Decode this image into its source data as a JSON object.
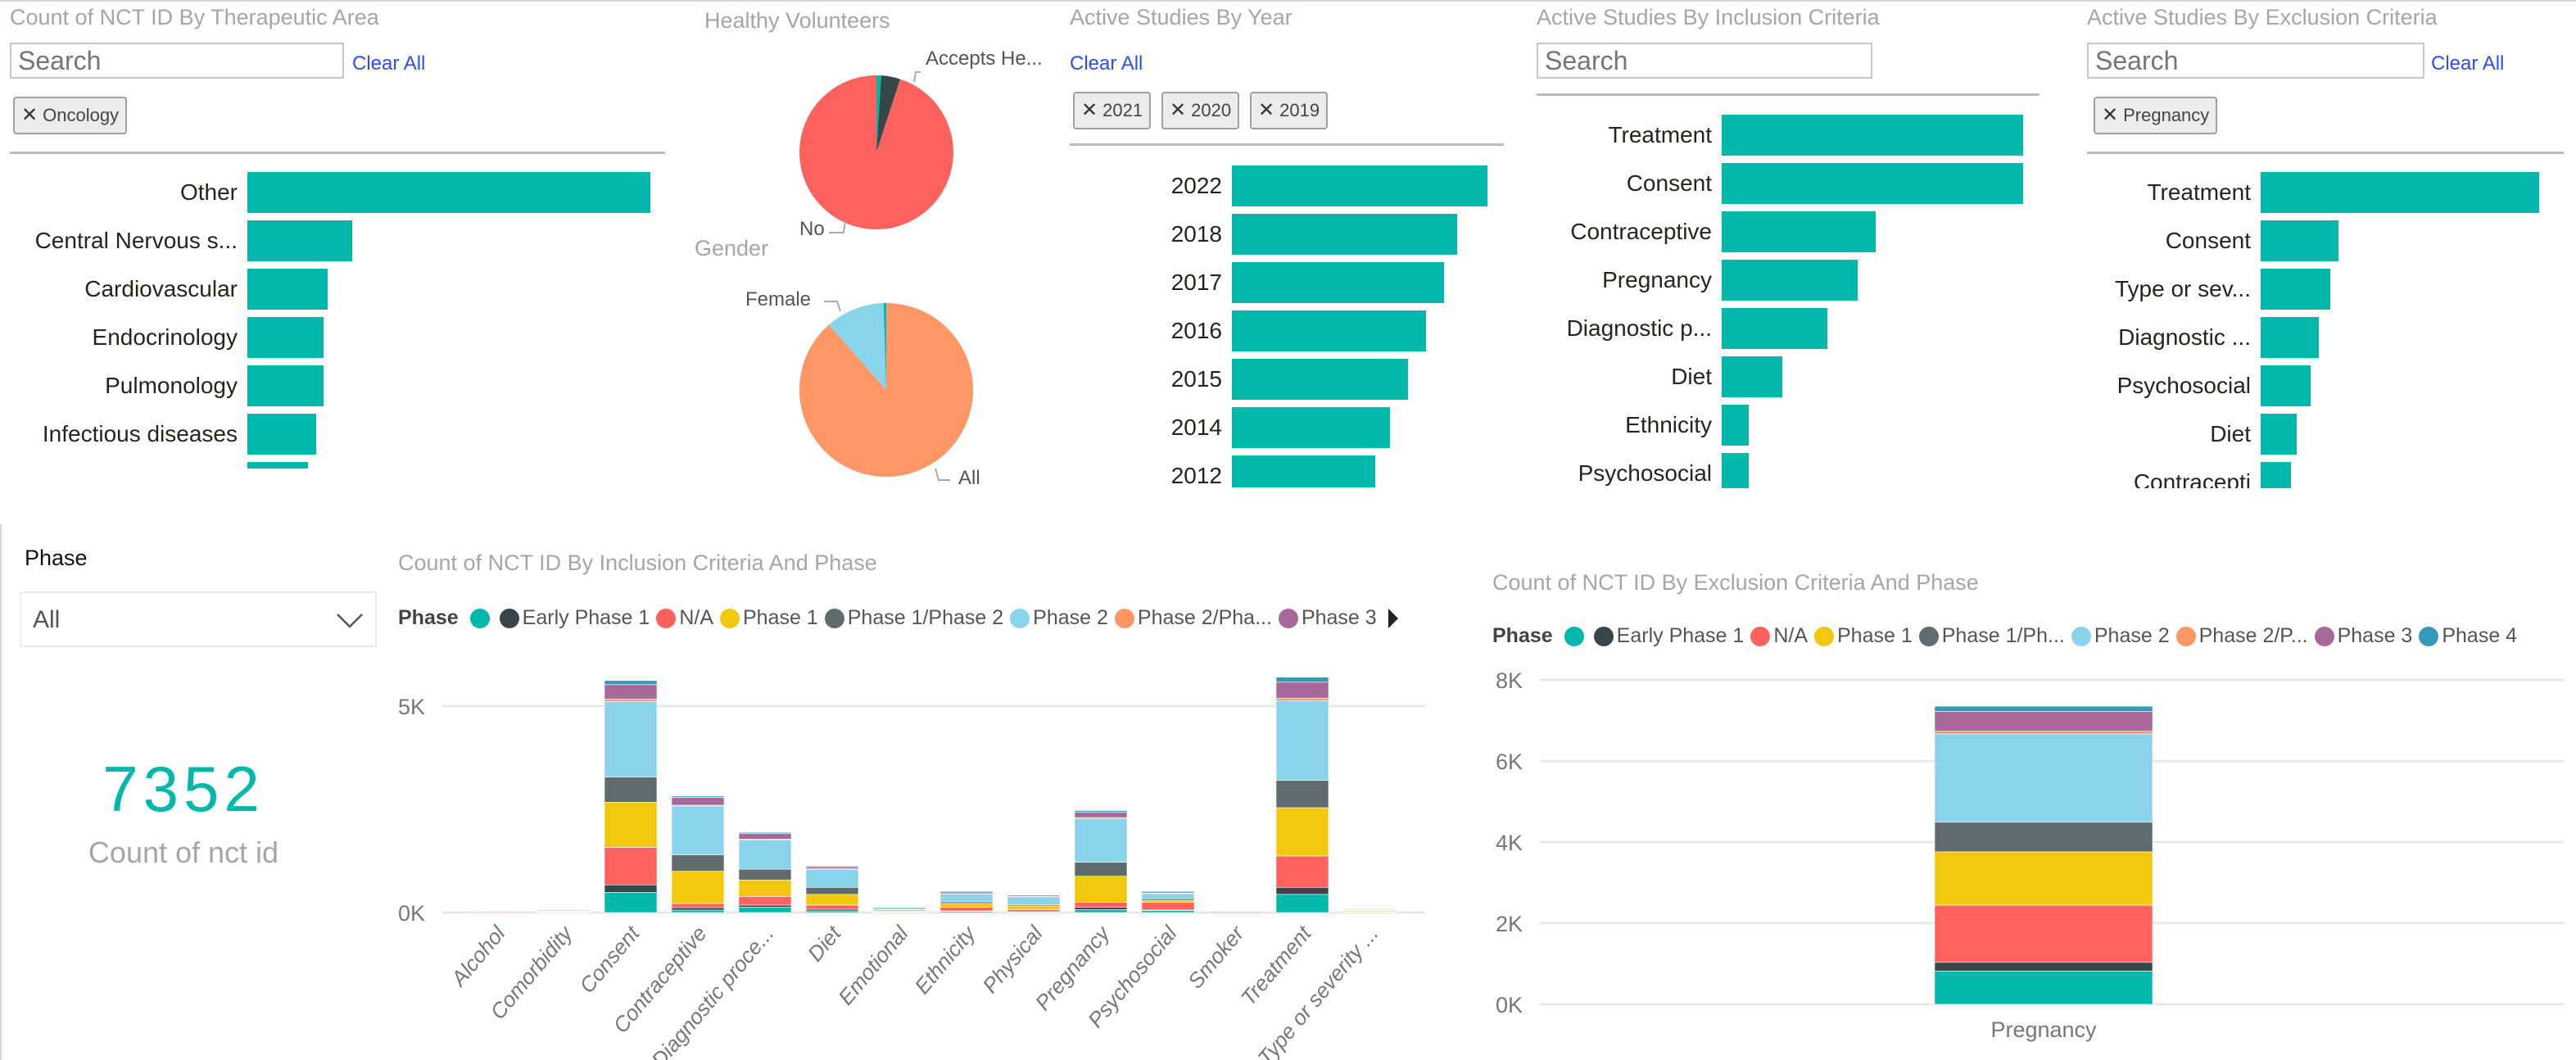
{
  "colors": {
    "accent": "#01B8AA",
    "link": "#2b4cff",
    "phase": [
      "#01B8AA",
      "#374649",
      "#FD625E",
      "#F2C80F",
      "#5F6B6D",
      "#8AD4EB",
      "#FE9666",
      "#A66999",
      "#3599B8"
    ]
  },
  "therapeutic": {
    "title": "Count of NCT ID By Therapeutic Area",
    "search_placeholder": "Search",
    "clear_all": "Clear All",
    "chips": [
      "Oncology"
    ],
    "items": [
      {
        "label": "Other",
        "value": 100
      },
      {
        "label": "Central Nervous s...",
        "value": 26
      },
      {
        "label": "Cardiovascular",
        "value": 20
      },
      {
        "label": "Endocrinology",
        "value": 19
      },
      {
        "label": "Pulmonology",
        "value": 19
      },
      {
        "label": "Infectious diseases",
        "value": 17
      },
      {
        "label": "",
        "value": 15
      }
    ]
  },
  "healthy": {
    "title": "Healthy Volunteers",
    "slices": [
      {
        "label": "",
        "value": 1,
        "color": "#01B8AA"
      },
      {
        "label": "Accepts He...",
        "value": 4,
        "color": "#374649"
      },
      {
        "label": "No",
        "value": 95,
        "color": "#FD625E"
      }
    ],
    "label_accepts": "Accepts He...",
    "label_no": "No"
  },
  "gender": {
    "title": "Gender",
    "slices": [
      {
        "label": "All",
        "value": 88.5,
        "color": "#FE9666"
      },
      {
        "label": "Female",
        "value": 11,
        "color": "#8AD4EB"
      },
      {
        "label": "",
        "value": 0.5,
        "color": "#01B8AA"
      }
    ],
    "label_female": "Female",
    "label_all": "All"
  },
  "year": {
    "title": "Active Studies By Year",
    "clear_all": "Clear All",
    "chips": [
      "2021",
      "2020",
      "2019"
    ],
    "items": [
      {
        "label": "2022",
        "value": 100
      },
      {
        "label": "2018",
        "value": 88
      },
      {
        "label": "2017",
        "value": 83
      },
      {
        "label": "2016",
        "value": 76
      },
      {
        "label": "2015",
        "value": 69
      },
      {
        "label": "2014",
        "value": 62
      },
      {
        "label": "2012",
        "value": 56
      }
    ]
  },
  "inclusion": {
    "title": "Active Studies By Inclusion Criteria",
    "search_placeholder": "Search",
    "items": [
      {
        "label": "Treatment",
        "value": 100
      },
      {
        "label": "Consent",
        "value": 100
      },
      {
        "label": "Contraceptive",
        "value": 51
      },
      {
        "label": "Pregnancy",
        "value": 45
      },
      {
        "label": "Diagnostic p...",
        "value": 35
      },
      {
        "label": "Diet",
        "value": 20
      },
      {
        "label": "Ethnicity",
        "value": 9
      },
      {
        "label": "Psychosocial",
        "value": 9
      }
    ]
  },
  "exclusion": {
    "title": "Active Studies By Exclusion Criteria",
    "search_placeholder": "Search",
    "clear_all": "Clear All",
    "chips": [
      "Pregnancy"
    ],
    "items": [
      {
        "label": "Treatment",
        "value": 100
      },
      {
        "label": "Consent",
        "value": 28
      },
      {
        "label": "Type or sev...",
        "value": 25
      },
      {
        "label": "Diagnostic ...",
        "value": 21
      },
      {
        "label": "Psychosocial",
        "value": 18
      },
      {
        "label": "Diet",
        "value": 13
      },
      {
        "label": "Contracepti",
        "value": 11
      }
    ]
  },
  "phase_slicer": {
    "label": "Phase",
    "selected": "All"
  },
  "kpi": {
    "value": "7352",
    "label": "Count of nct id"
  },
  "chart_data": [
    {
      "type": "bar",
      "stacked": true,
      "title": "Count of NCT ID By Inclusion Criteria And Phase",
      "legend_title": "Phase",
      "legend": [
        "",
        "Early Phase 1",
        "N/A",
        "Phase 1",
        "Phase 1/Phase 2",
        "Phase 2",
        "Phase 2/Pha...",
        "Phase 3"
      ],
      "legend_placement": "top-left",
      "yticks": [
        "0K",
        "5K"
      ],
      "ylim": [
        0,
        5800
      ],
      "grid": true,
      "categories": [
        "Alcohol",
        "Comorbidity",
        "Consent",
        "Contraceptive",
        "Diagnostic proce...",
        "Diet",
        "Emotional",
        "Ethnicity",
        "Physical",
        "Pregnancy",
        "Psychosocial",
        "Smoker",
        "Treatment",
        "Type or severity ..."
      ],
      "series": [
        {
          "values": [
            5,
            5,
            490,
            60,
            130,
            40,
            10,
            30,
            10,
            70,
            50,
            3,
            440,
            10
          ]
        },
        {
          "name": "Early Phase 1",
          "values": [
            3,
            3,
            180,
            60,
            50,
            40,
            10,
            10,
            10,
            60,
            10,
            3,
            170,
            5
          ]
        },
        {
          "name": "N/A",
          "values": [
            20,
            10,
            910,
            100,
            210,
            100,
            15,
            90,
            50,
            120,
            190,
            20,
            760,
            10
          ]
        },
        {
          "name": "Phase 1",
          "values": [
            10,
            10,
            1090,
            780,
            400,
            260,
            30,
            90,
            90,
            630,
            50,
            3,
            1170,
            20
          ]
        },
        {
          "name": "Phase 1/Phase 2",
          "values": [
            5,
            5,
            610,
            400,
            260,
            170,
            10,
            40,
            30,
            340,
            40,
            3,
            660,
            10
          ]
        },
        {
          "name": "Phase 2",
          "values": [
            10,
            25,
            1830,
            1180,
            710,
            430,
            50,
            190,
            190,
            1050,
            120,
            5,
            1930,
            20
          ]
        },
        {
          "values": [
            3,
            3,
            60,
            20,
            20,
            20,
            3,
            10,
            10,
            30,
            10,
            3,
            60,
            2
          ]
        },
        {
          "name": "Phase 3",
          "values": [
            3,
            5,
            350,
            190,
            130,
            50,
            5,
            40,
            30,
            130,
            30,
            3,
            390,
            5
          ]
        },
        {
          "values": [
            2,
            3,
            100,
            30,
            30,
            20,
            3,
            20,
            10,
            40,
            20,
            2,
            120,
            2
          ]
        }
      ]
    },
    {
      "type": "bar",
      "stacked": true,
      "title": "Count of NCT ID By Exclusion Criteria And Phase",
      "legend_title": "Phase",
      "legend": [
        "",
        "Early Phase 1",
        "N/A",
        "Phase 1",
        "Phase 1/Ph...",
        "Phase 2",
        "Phase 2/P...",
        "Phase 3",
        "Phase 4"
      ],
      "legend_placement": "top-left",
      "yticks": [
        "0K",
        "2K",
        "4K",
        "6K",
        "8K"
      ],
      "ylim": [
        0,
        8000
      ],
      "grid": true,
      "categories": [
        "Pregnancy"
      ],
      "series": [
        {
          "values": [
            820
          ]
        },
        {
          "name": "Early Phase 1",
          "values": [
            215
          ]
        },
        {
          "name": "N/A",
          "values": [
            1410
          ]
        },
        {
          "name": "Phase 1",
          "values": [
            1315
          ]
        },
        {
          "name": "Phase 1/Ph...",
          "values": [
            735
          ]
        },
        {
          "name": "Phase 2",
          "values": [
            2175
          ]
        },
        {
          "name": "Phase 2/P...",
          "values": [
            65
          ]
        },
        {
          "name": "Phase 3",
          "values": [
            485
          ]
        },
        {
          "name": "Phase 4",
          "values": [
            132
          ]
        }
      ]
    }
  ]
}
